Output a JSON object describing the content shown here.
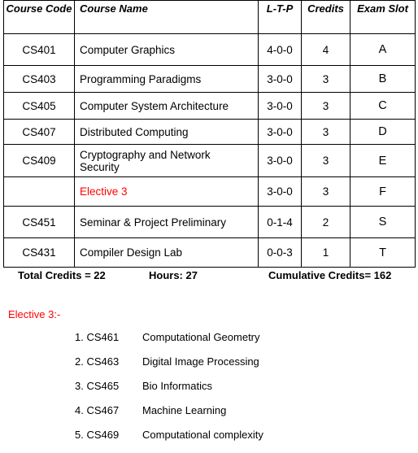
{
  "table": {
    "headers": {
      "code": "Course Code",
      "name": "Course Name",
      "ltp": "L-T-P",
      "credits": "Credits",
      "exam_slot": "Exam Slot"
    },
    "rows": [
      {
        "code": "CS401",
        "name": "Computer Graphics",
        "ltp": "4-0-0",
        "credits": "4",
        "slot": "A"
      },
      {
        "code": "CS403",
        "name": "Programming Paradigms",
        "ltp": "3-0-0",
        "credits": "3",
        "slot": "B"
      },
      {
        "code": "CS405",
        "name": "Computer System Architecture",
        "ltp": "3-0-0",
        "credits": "3",
        "slot": "C"
      },
      {
        "code": "CS407",
        "name": "Distributed Computing",
        "ltp": "3-0-0",
        "credits": "3",
        "slot": "D"
      },
      {
        "code": "CS409",
        "name": "Cryptography and Network Security",
        "ltp": "3-0-0",
        "credits": "3",
        "slot": "E"
      },
      {
        "code": "",
        "name": "Elective 3",
        "ltp": "3-0-0",
        "credits": "3",
        "slot": "F"
      },
      {
        "code": "CS451",
        "name": "Seminar & Project Preliminary",
        "ltp": "0-1-4",
        "credits": "2",
        "slot": "S"
      },
      {
        "code": "CS431",
        "name": "Compiler Design Lab",
        "ltp": "0-0-3",
        "credits": "1",
        "slot": "T"
      }
    ]
  },
  "summary": {
    "total_credits": "Total Credits = 22",
    "hours": "Hours: 27",
    "cumulative": "Cumulative Credits= 162"
  },
  "elective": {
    "heading": "Elective 3:-",
    "items": [
      {
        "num": "1. CS461",
        "name": "Computational Geometry"
      },
      {
        "num": "2. CS463",
        "name": "Digital Image Processing"
      },
      {
        "num": "3. CS465",
        "name": "Bio Informatics"
      },
      {
        "num": "4. CS467",
        "name": "Machine Learning"
      },
      {
        "num": "5. CS469",
        "name": "Computational complexity"
      }
    ]
  },
  "colors": {
    "highlight": "#ff0000",
    "text": "#000000"
  }
}
